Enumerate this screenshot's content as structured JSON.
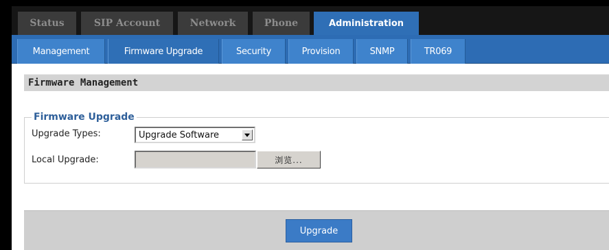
{
  "top_tabs": [
    {
      "label": "Status",
      "active": false
    },
    {
      "label": "SIP Account",
      "active": false
    },
    {
      "label": "Network",
      "active": false
    },
    {
      "label": "Phone",
      "active": false
    },
    {
      "label": "Administration",
      "active": true
    }
  ],
  "sub_tabs": [
    {
      "label": "Management",
      "active": false
    },
    {
      "label": "Firmware Upgrade",
      "active": true
    },
    {
      "label": "Security",
      "active": false
    },
    {
      "label": "Provision",
      "active": false
    },
    {
      "label": "SNMP",
      "active": false
    },
    {
      "label": "TR069",
      "active": false
    }
  ],
  "section": {
    "title": "Firmware Management"
  },
  "form": {
    "legend": "Firmware Upgrade",
    "upgrade_types_label": "Upgrade Types:",
    "upgrade_types_value": "Upgrade Software",
    "local_upgrade_label": "Local Upgrade:",
    "local_upgrade_value": "",
    "browse_label": "浏览..."
  },
  "footer": {
    "upgrade_label": "Upgrade"
  },
  "colors": {
    "accent_blue": "#2f6fb6",
    "top_bar": "#161616",
    "inactive_tab": "#3b3b3b"
  },
  "icons": {
    "select_arrow": "triangle-down"
  }
}
